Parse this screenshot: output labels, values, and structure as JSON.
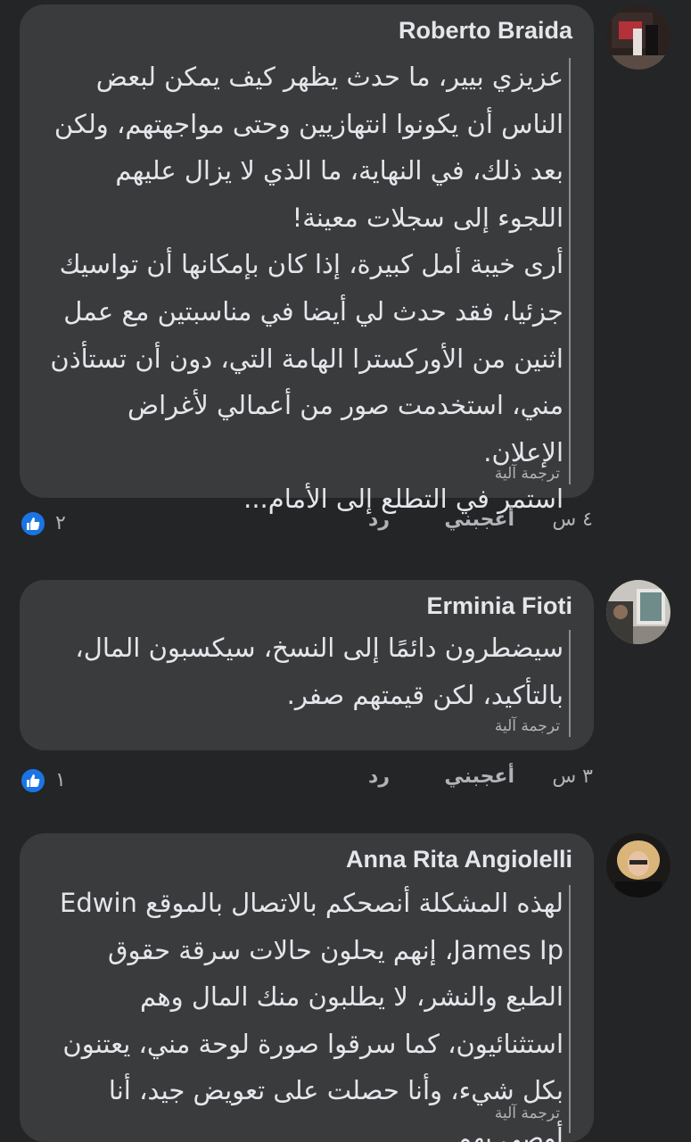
{
  "comments": [
    {
      "author": "Roberto Braida",
      "text": "عزيزي بيير، ما حدث يظهر كيف يمكن لبعض الناس أن يكونوا انتهازيين وحتى مواجهتهم، ولكن بعد ذلك، في النهاية، ما الذي لا يزال عليهم اللجوء إلى سجلات معينة!\nأرى خيبة أمل كبيرة، إذا كان بإمكانها أن تواسيك جزئيا، فقد حدث لي أيضا في مناسبتين مع عمل اثنين من الأوركسترا الهامة التي، دون أن تستأذن مني، استخدمت صور من أعمالي لأغراض الإعلان.\nاستمر في التطلع إلى الأمام...",
      "translation_label": "ترجمة آلية",
      "time": "٤ س",
      "like_label": "أعجبني",
      "reply_label": "رد",
      "reactions": "٢"
    },
    {
      "author": "Erminia Fioti",
      "text": "سيضطرون دائمًا إلى النسخ، سيكسبون المال، بالتأكيد، لكن قيمتهم صفر.",
      "translation_label": "ترجمة آلية",
      "time": "٣ س",
      "like_label": "أعجبني",
      "reply_label": "رد",
      "reactions": "١"
    },
    {
      "author": "Anna Rita Angiolelli",
      "text": "لهذه المشكلة أنصحكم بالاتصال بالموقع Edwin James Ip، إنهم يحلون حالات سرقة حقوق الطبع والنشر، لا يطلبون منك المال وهم استثنائيون، كما سرقوا صورة لوحة مني، يعتنون بكل شيء، وأنا حصلت على تعويض جيد، أنا أوصي بهم",
      "translation_label": "ترجمة آلية"
    }
  ],
  "icons": {
    "like": "thumbs-up-icon"
  },
  "colors": {
    "background": "#242526",
    "bubble": "#3a3b3c",
    "like_blue": "#1b74e4"
  }
}
